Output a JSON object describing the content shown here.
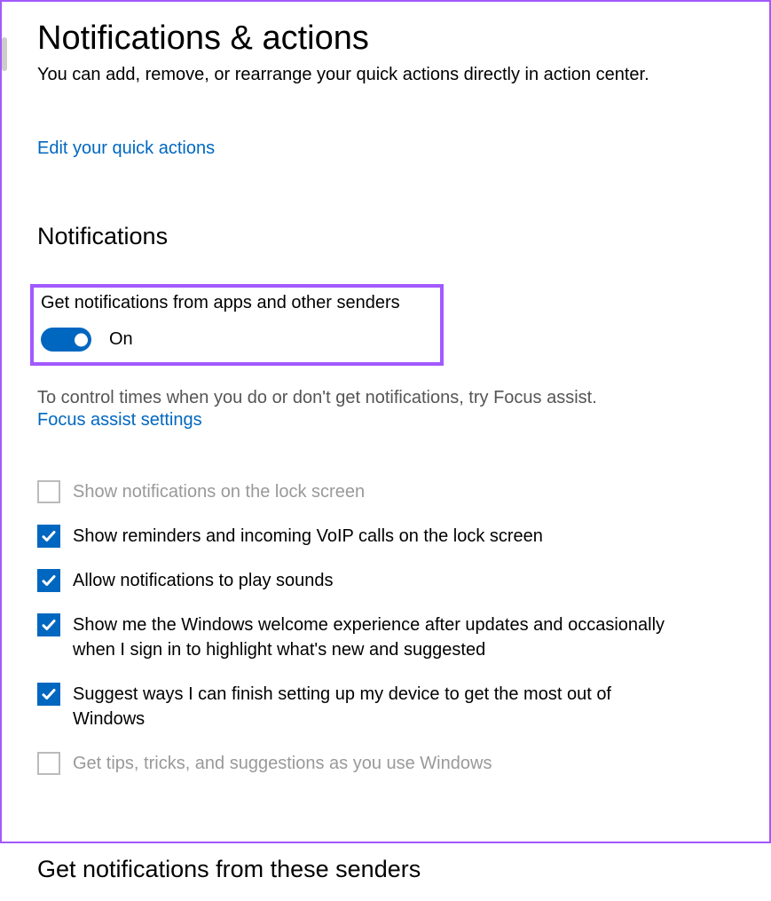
{
  "page": {
    "title": "Notifications & actions",
    "quick_description": "You can add, remove, or rearrange your quick actions directly in action center.",
    "edit_link": "Edit your quick actions"
  },
  "notifications": {
    "heading": "Notifications",
    "toggle": {
      "label": "Get notifications from apps and other senders",
      "state": "On",
      "value": true
    },
    "focus_text": "To control times when you do or don't get notifications, try Focus assist.",
    "focus_link": "Focus assist settings",
    "checkboxes": [
      {
        "label": "Show notifications on the lock screen",
        "checked": false,
        "disabled": true
      },
      {
        "label": "Show reminders and incoming VoIP calls on the lock screen",
        "checked": true,
        "disabled": false
      },
      {
        "label": "Allow notifications to play sounds",
        "checked": true,
        "disabled": false
      },
      {
        "label": "Show me the Windows welcome experience after updates and occasionally when I sign in to highlight what's new and suggested",
        "checked": true,
        "disabled": false
      },
      {
        "label": "Suggest ways I can finish setting up my device to get the most out of Windows",
        "checked": true,
        "disabled": false
      },
      {
        "label": "Get tips, tricks, and suggestions as you use Windows",
        "checked": false,
        "disabled": true
      }
    ]
  },
  "senders": {
    "heading": "Get notifications from these senders"
  }
}
